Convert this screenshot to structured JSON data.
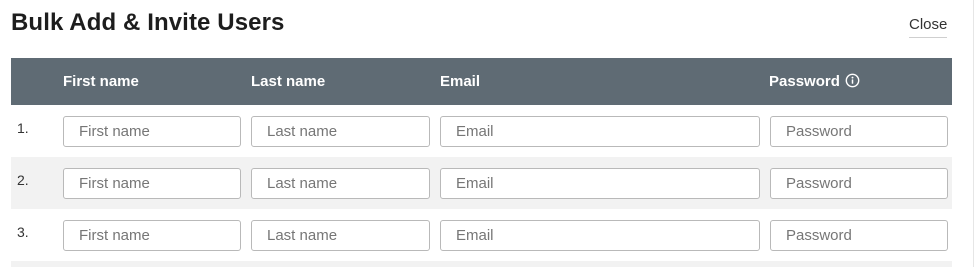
{
  "dialog": {
    "title": "Bulk Add & Invite Users",
    "close_label": "Close"
  },
  "table": {
    "headers": {
      "first_name": "First name",
      "last_name": "Last name",
      "email": "Email",
      "password": "Password"
    },
    "password_info_icon": "info-circle-icon",
    "header_color": "#5f6b74",
    "alt_row_color": "#f2f2f2",
    "rows": [
      {
        "number": "1.",
        "first_name": {
          "value": "",
          "placeholder": "First name"
        },
        "last_name": {
          "value": "",
          "placeholder": "Last name"
        },
        "email": {
          "value": "",
          "placeholder": "Email"
        },
        "password": {
          "value": "",
          "placeholder": "Password"
        }
      },
      {
        "number": "2.",
        "first_name": {
          "value": "",
          "placeholder": "First name"
        },
        "last_name": {
          "value": "",
          "placeholder": "Last name"
        },
        "email": {
          "value": "",
          "placeholder": "Email"
        },
        "password": {
          "value": "",
          "placeholder": "Password"
        }
      },
      {
        "number": "3.",
        "first_name": {
          "value": "",
          "placeholder": "First name"
        },
        "last_name": {
          "value": "",
          "placeholder": "Last name"
        },
        "email": {
          "value": "",
          "placeholder": "Email"
        },
        "password": {
          "value": "",
          "placeholder": "Password"
        }
      }
    ]
  }
}
